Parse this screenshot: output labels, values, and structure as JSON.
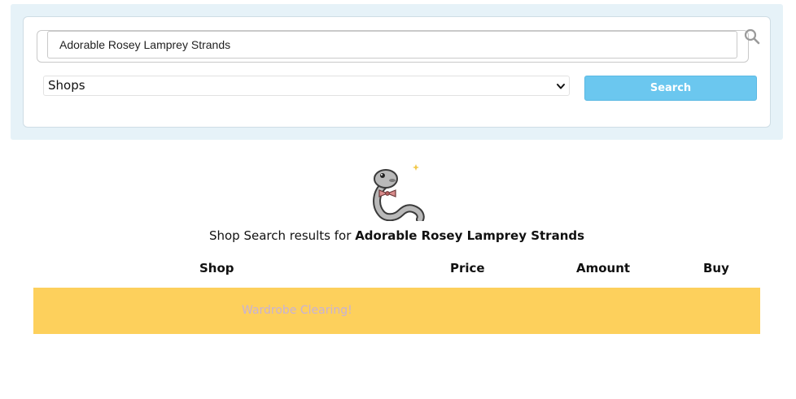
{
  "search": {
    "query_value": "Adorable Rosey Lamprey Strands",
    "search_icon": "magnifier-icon",
    "type_select": {
      "selected": "Shops",
      "icon": "chevron-down-icon"
    },
    "button_label": "Search",
    "button_color": "#6bc7ef"
  },
  "results": {
    "mascot": "lamprey-mascot-with-bow",
    "heading_prefix": "Shop Search results for",
    "heading_query": "Adorable Rosey Lamprey Strands",
    "columns": [
      "Shop",
      "Price",
      "Amount",
      "Buy"
    ],
    "rows": [
      {
        "shop": "Wardrobe Clearing!",
        "price": "",
        "amount": "",
        "buy": "",
        "row_color": "#fdd05c",
        "link_color": "#c7b2d6"
      }
    ]
  }
}
